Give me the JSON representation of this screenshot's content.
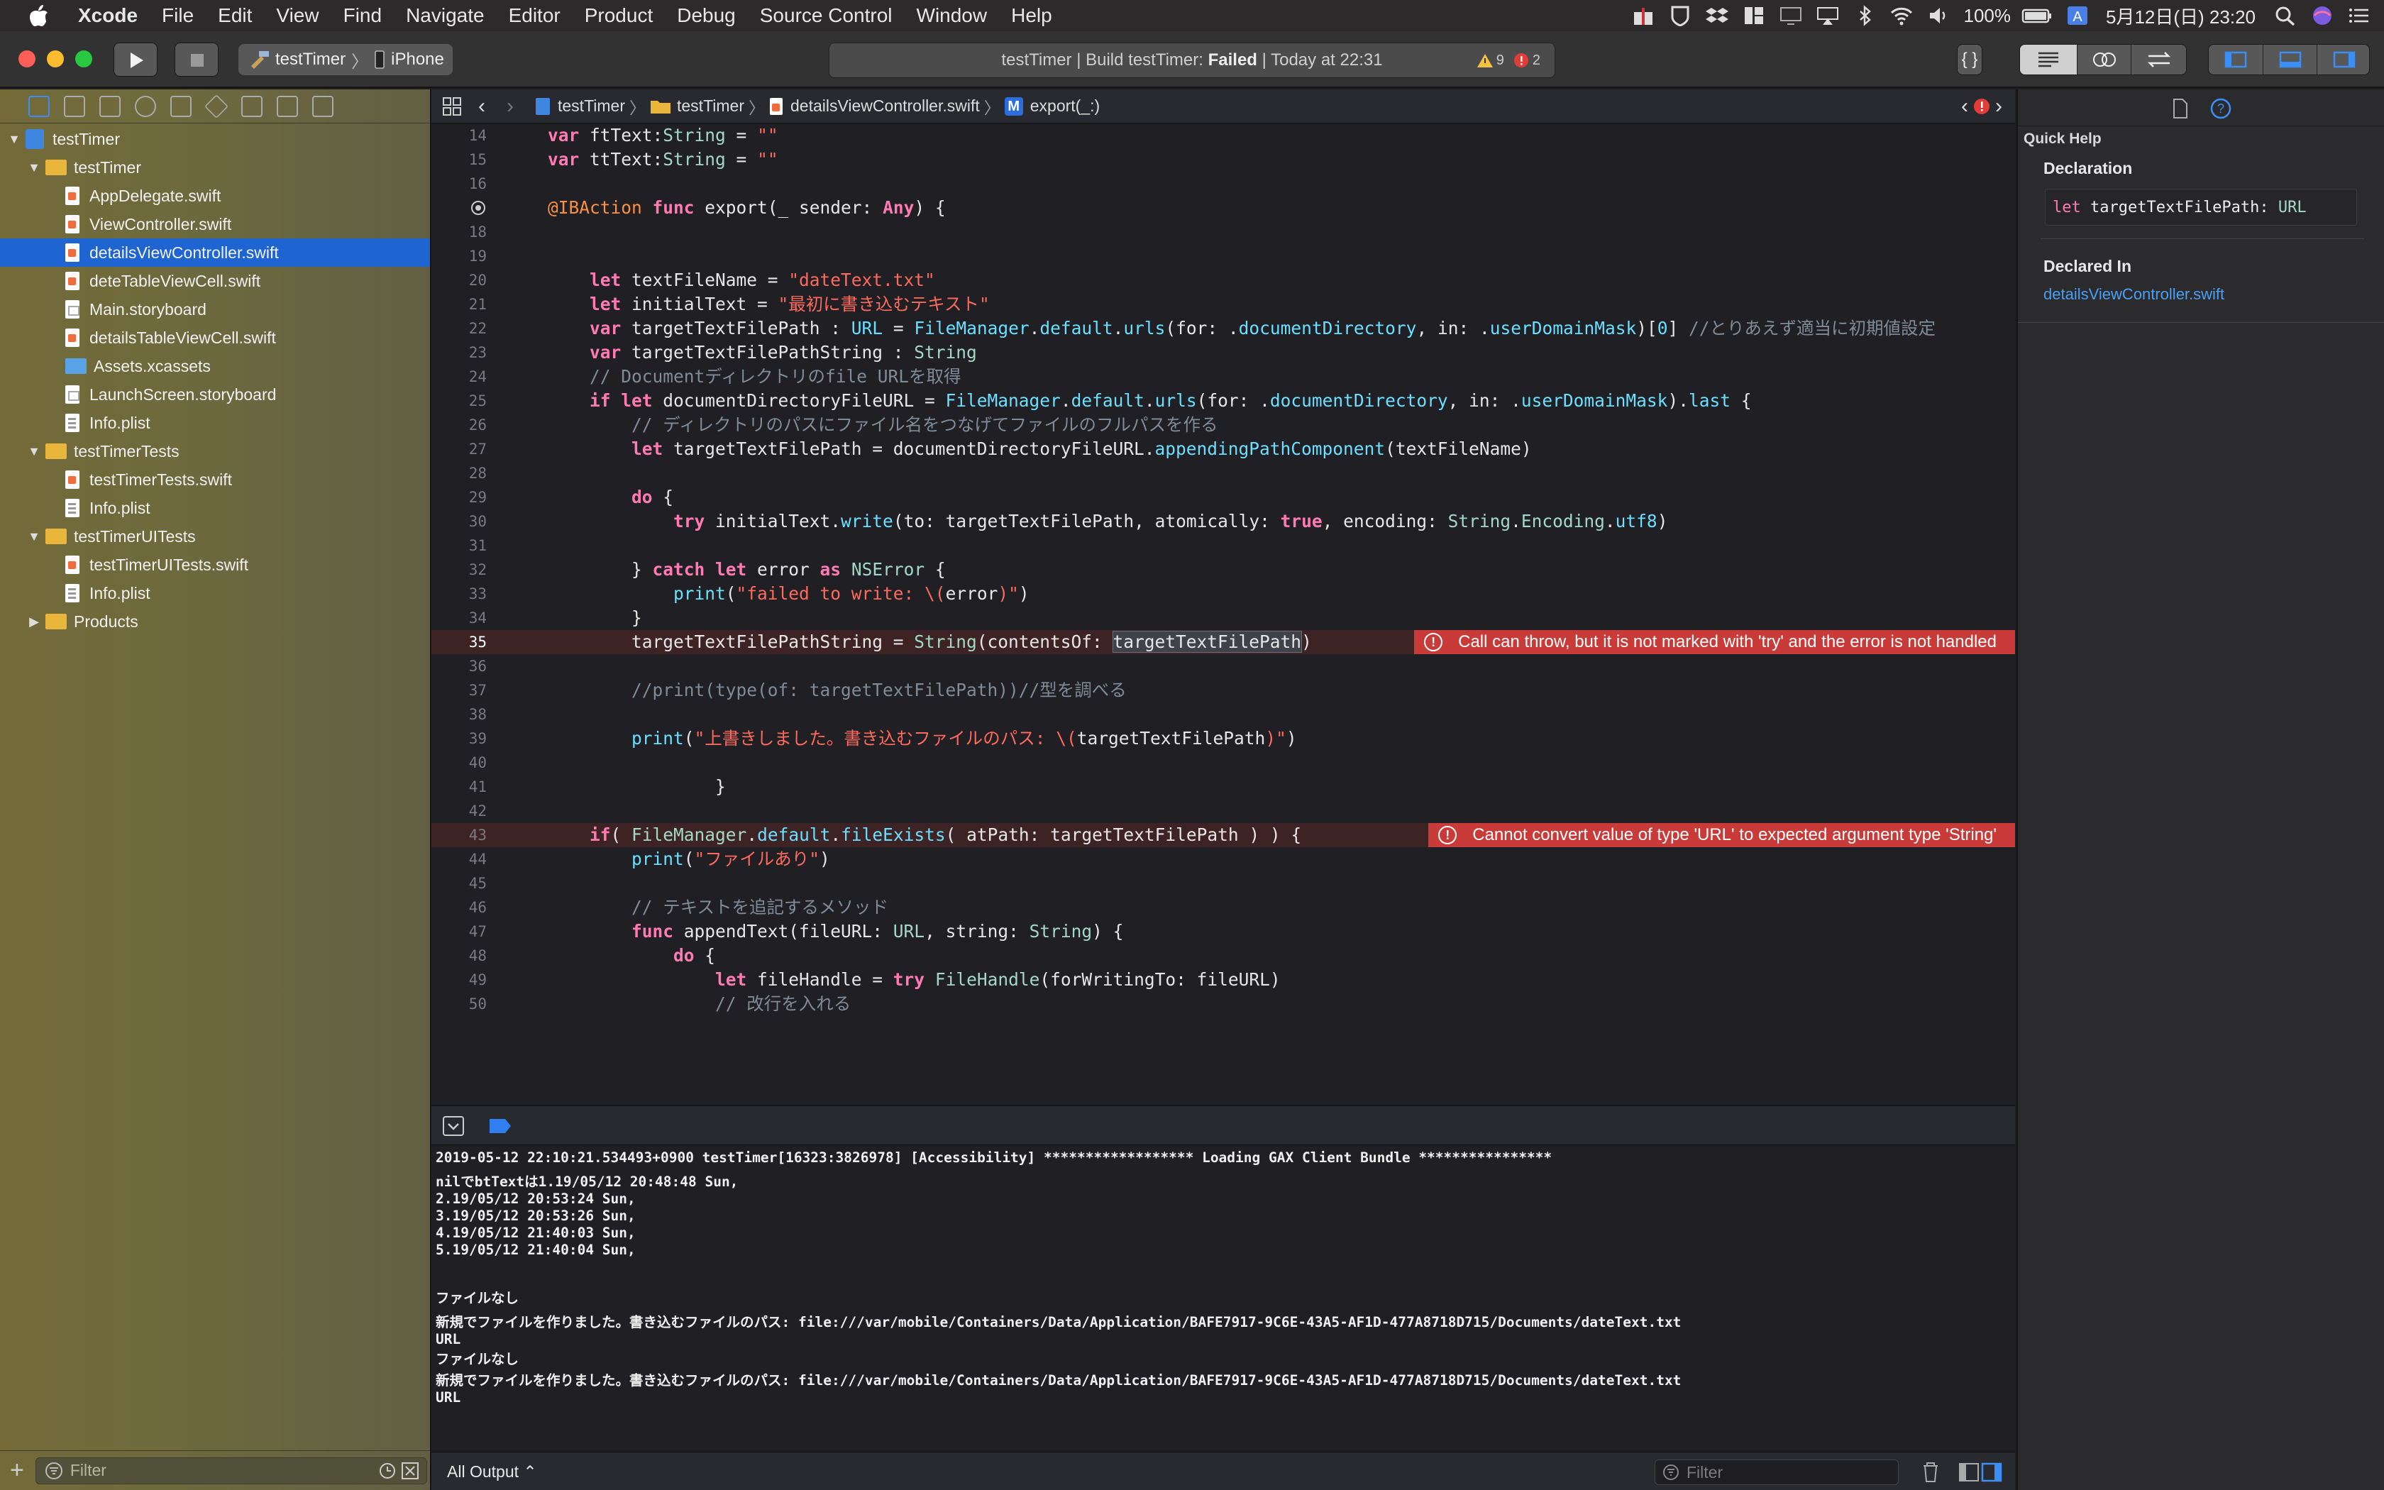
{
  "menubar": {
    "app_name": "Xcode",
    "items": [
      "File",
      "Edit",
      "View",
      "Find",
      "Navigate",
      "Editor",
      "Product",
      "Debug",
      "Source Control",
      "Window",
      "Help"
    ],
    "battery": "100%",
    "clock": "5月12日(日)  23:20"
  },
  "toolbar": {
    "scheme": "testTimer",
    "destination": "iPhone",
    "activity": "testTimer | Build testTimer: Failed | Today at 22:31",
    "activity_prefix": "testTimer | Build testTimer: ",
    "activity_status": "Failed",
    "activity_suffix": " | Today at 22:31",
    "warnings": "9",
    "errors": "2"
  },
  "navigator": {
    "filter_placeholder": "Filter",
    "tree": [
      {
        "label": "testTimer",
        "level": 0,
        "kind": "project",
        "disclosure": "▼"
      },
      {
        "label": "testTimer",
        "level": 1,
        "kind": "folder",
        "disclosure": "▼"
      },
      {
        "label": "AppDelegate.swift",
        "level": 2,
        "kind": "swift"
      },
      {
        "label": "ViewController.swift",
        "level": 2,
        "kind": "swift"
      },
      {
        "label": "detailsViewController.swift",
        "level": 2,
        "kind": "swift",
        "selected": true
      },
      {
        "label": "deteTableViewCell.swift",
        "level": 2,
        "kind": "swift"
      },
      {
        "label": "Main.storyboard",
        "level": 2,
        "kind": "storyboard"
      },
      {
        "label": "detailsTableViewCell.swift",
        "level": 2,
        "kind": "swift"
      },
      {
        "label": "Assets.xcassets",
        "level": 2,
        "kind": "assets"
      },
      {
        "label": "LaunchScreen.storyboard",
        "level": 2,
        "kind": "storyboard"
      },
      {
        "label": "Info.plist",
        "level": 2,
        "kind": "plist"
      },
      {
        "label": "testTimerTests",
        "level": 1,
        "kind": "folder",
        "disclosure": "▼"
      },
      {
        "label": "testTimerTests.swift",
        "level": 2,
        "kind": "swift"
      },
      {
        "label": "Info.plist",
        "level": 2,
        "kind": "plist"
      },
      {
        "label": "testTimerUITests",
        "level": 1,
        "kind": "folder",
        "disclosure": "▼"
      },
      {
        "label": "testTimerUITests.swift",
        "level": 2,
        "kind": "swift"
      },
      {
        "label": "Info.plist",
        "level": 2,
        "kind": "plist"
      },
      {
        "label": "Products",
        "level": 1,
        "kind": "folder",
        "disclosure": "▶"
      }
    ]
  },
  "jumpbar": {
    "crumbs": [
      "testTimer",
      "testTimer",
      "detailsViewController.swift",
      "export(_:)"
    ],
    "method_badge": "M"
  },
  "code_lines": [
    {
      "n": "14",
      "html": "<span class=\"k\">var</span> ftText:<span class=\"t\">String</span> = <span class=\"s\">\"\"</span>"
    },
    {
      "n": "15",
      "html": "<span class=\"k\">var</span> ttText:<span class=\"t\">String</span> = <span class=\"s\">\"\"</span>"
    },
    {
      "n": "16",
      "html": ""
    },
    {
      "n": "",
      "html": "<span class=\"a\">@IBAction</span> <span class=\"k\">func</span> export(_ sender: <span class=\"k\">Any</span>) {",
      "breakpoint": true
    },
    {
      "n": "18",
      "html": ""
    },
    {
      "n": "19",
      "html": ""
    },
    {
      "n": "20",
      "html": "    <span class=\"k\">let</span> textFileName = <span class=\"s\">\"dateText.txt\"</span>"
    },
    {
      "n": "21",
      "html": "    <span class=\"k\">let</span> initialText = <span class=\"s\">\"最初に書き込むテキスト\"</span>"
    },
    {
      "n": "22",
      "html": "    <span class=\"k\">var</span> targetTextFilePath : <span class=\"t2\">URL</span> = <span class=\"t2\">FileManager</span>.<span class=\"t2\">default</span>.<span class=\"t2\">urls</span>(for: .<span class=\"t2\">documentDirectory</span>, in: .<span class=\"t2\">userDomainMask</span>)[<span class=\"t2\">0</span>] <span class=\"c\">//とりあえず適当に初期値設定</span>"
    },
    {
      "n": "23",
      "html": "    <span class=\"k\">var</span> targetTextFilePathString : <span class=\"t\">String</span>"
    },
    {
      "n": "24",
      "html": "    <span class=\"c\">// Documentディレクトリのfile URLを取得</span>"
    },
    {
      "n": "25",
      "html": "    <span class=\"k\">if let</span> documentDirectoryFileURL = <span class=\"t2\">FileManager</span>.<span class=\"t2\">default</span>.<span class=\"t2\">urls</span>(for: .<span class=\"t2\">documentDirectory</span>, in: .<span class=\"t2\">userDomainMask</span>).<span class=\"t2\">last</span> {"
    },
    {
      "n": "26",
      "html": "        <span class=\"c\">// ディレクトリのパスにファイル名をつなげてファイルのフルパスを作る</span>"
    },
    {
      "n": "27",
      "html": "        <span class=\"k\">let</span> targetTextFilePath = documentDirectoryFileURL.<span class=\"t2\">appendingPathComponent</span>(textFileName)"
    },
    {
      "n": "28",
      "html": ""
    },
    {
      "n": "29",
      "html": "        <span class=\"k\">do</span> {"
    },
    {
      "n": "30",
      "html": "            <span class=\"k\">try</span> initialText.<span class=\"t2\">write</span>(to: targetTextFilePath, atomically: <span class=\"k\">true</span>, encoding: <span class=\"t\">String</span>.<span class=\"t\">Encoding</span>.<span class=\"t2\">utf8</span>)"
    },
    {
      "n": "31",
      "html": ""
    },
    {
      "n": "32",
      "html": "        } <span class=\"k\">catch let</span> error <span class=\"k\">as</span> <span class=\"t\">NSError</span> {"
    },
    {
      "n": "33",
      "html": "            <span class=\"t2\">print</span>(<span class=\"s\">\"failed to write: \\(</span>error<span class=\"s\">)\"</span>)"
    },
    {
      "n": "34",
      "html": "        }"
    },
    {
      "n": "35",
      "html": "        targetTextFilePathString = <span class=\"t\">String</span>(contentsOf: <span class=\"hl\">targetTextFilePath</span>)",
      "error": "Call can throw, but it is not marked with 'try' and the error is not handled",
      "current": true
    },
    {
      "n": "36",
      "html": ""
    },
    {
      "n": "37",
      "html": "        <span class=\"c\">//print(type(of: targetTextFilePath))//型を調べる</span>"
    },
    {
      "n": "38",
      "html": ""
    },
    {
      "n": "39",
      "html": "        <span class=\"t2\">print</span>(<span class=\"s\">\"上書きしました。書き込むファイルのパス: \\(</span>targetTextFilePath<span class=\"s\">)\"</span>)"
    },
    {
      "n": "40",
      "html": ""
    },
    {
      "n": "41",
      "html": "                }"
    },
    {
      "n": "42",
      "html": ""
    },
    {
      "n": "43",
      "html": "    <span class=\"k\">if</span>( <span class=\"t\">FileManager</span>.<span class=\"t2\">default</span>.<span class=\"t2\">fileExists</span>( atPath: targetTextFilePath ) ) {",
      "error": "Cannot convert value of type 'URL' to expected argument type 'String'"
    },
    {
      "n": "44",
      "html": "        <span class=\"t2\">print</span>(<span class=\"s\">\"ファイルあり\"</span>)"
    },
    {
      "n": "45",
      "html": ""
    },
    {
      "n": "46",
      "html": "        <span class=\"c\">// テキストを追記するメソッド</span>"
    },
    {
      "n": "47",
      "html": "        <span class=\"k\">func</span> appendText(fileURL: <span class=\"t\">URL</span>, string: <span class=\"t\">String</span>) {"
    },
    {
      "n": "48",
      "html": "            <span class=\"k\">do</span> {"
    },
    {
      "n": "49",
      "html": "                <span class=\"k\">let</span> fileHandle = <span class=\"k\">try</span> <span class=\"t\">FileHandle</span>(forWritingTo: fileURL)"
    },
    {
      "n": "50",
      "html": "                <span class=\"c\">// 改行を入れる</span>"
    }
  ],
  "console": {
    "lines": [
      "2019-05-12 22:10:21.534493+0900 testTimer[16323:3826978] [Accessibility] ****************** Loading GAX Client Bundle ****************",
      "nilでbtTextは1.19/05/12 20:48:48 Sun,",
      "2.19/05/12 20:53:24 Sun,",
      "3.19/05/12 20:53:26 Sun,",
      "4.19/05/12 21:40:03 Sun,",
      "5.19/05/12 21:40:04 Sun,",
      "",
      "ファイルなし",
      "新規でファイルを作りました。書き込むファイルのパス: file:///var/mobile/Containers/Data/Application/BAFE7917-9C6E-43A5-AF1D-477A8718D715/Documents/dateText.txt",
      "URL",
      "ファイルなし",
      "新規でファイルを作りました。書き込むファイルのパス: file:///var/mobile/Containers/Data/Application/BAFE7917-9C6E-43A5-AF1D-477A8718D715/Documents/dateText.txt",
      "URL"
    ],
    "output_selector": "All Output ⌃",
    "filter_placeholder": "Filter"
  },
  "inspector": {
    "title": "Quick Help",
    "declaration_label": "Declaration",
    "declaration_keyword": "let",
    "declaration_name": "targetTextFilePath:",
    "declaration_type": "URL",
    "declared_in_label": "Declared In",
    "declared_in_value": "detailsViewController.swift"
  },
  "colors": {
    "selection": "#1f65d1",
    "error": "#c83b38",
    "link": "#4a9ff5"
  }
}
